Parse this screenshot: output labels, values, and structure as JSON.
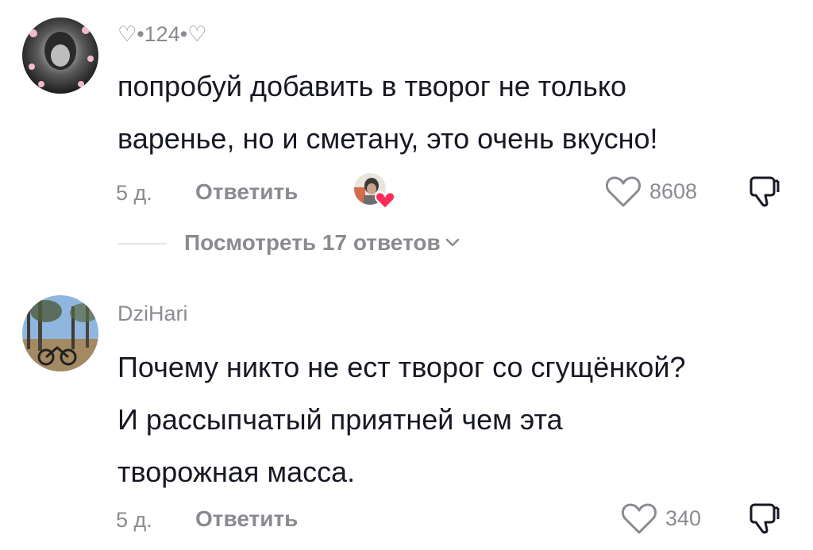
{
  "comments": [
    {
      "username": "♡•124•♡",
      "text_lines": [
        "попробуй добавить в творог не только",
        "варенье, но и сметану, это очень вкусно!"
      ],
      "time": "5 д.",
      "reply_label": "Ответить",
      "likes": "8608",
      "view_replies_label": "Посмотреть 17 ответов"
    },
    {
      "username": "DziHari",
      "text_lines": [
        "Почему никто не ест творог со сгущёнкой?",
        "И рассыпчатый приятней чем эта",
        "творожная масса."
      ],
      "time": "5 д.",
      "reply_label": "Ответить",
      "likes": "340"
    }
  ],
  "colors": {
    "text": "#161823",
    "muted": "#8a8b91",
    "heart_badge": "#fe2c55"
  },
  "icons": [
    "heart-outline-icon",
    "dislike-icon",
    "chevron-down-icon",
    "creator-liked-heart-icon"
  ]
}
